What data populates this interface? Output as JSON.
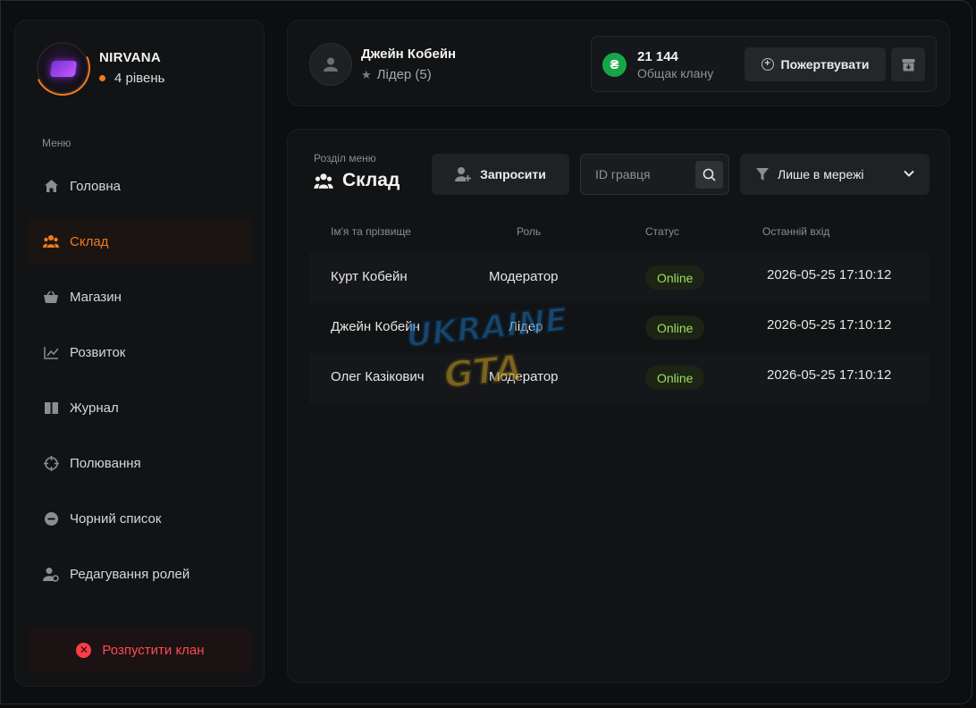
{
  "clan": {
    "name": "NIRVANA",
    "level": "4 рівень"
  },
  "sidebar": {
    "caption": "Меню",
    "items": [
      {
        "label": "Головна",
        "icon": "home-icon"
      },
      {
        "label": "Склад",
        "icon": "people-icon",
        "active": true
      },
      {
        "label": "Магазин",
        "icon": "basket-icon"
      },
      {
        "label": "Розвиток",
        "icon": "chart-icon"
      },
      {
        "label": "Журнал",
        "icon": "book-icon"
      },
      {
        "label": "Полювання",
        "icon": "crosshair-icon"
      },
      {
        "label": "Чорний список",
        "icon": "block-icon"
      },
      {
        "label": "Редагування ролей",
        "icon": "user-gear-icon"
      }
    ],
    "disband_label": "Розпустити клан"
  },
  "user": {
    "name": "Джейн Кобейн",
    "role": "Лідер (5)"
  },
  "treasury": {
    "amount": "21 144",
    "label": "Общак клану",
    "currency_symbol": "₴",
    "donate_label": "Пожертвувати"
  },
  "section": {
    "caption": "Розділ меню",
    "title": "Склад",
    "invite_label": "Запросити",
    "search_placeholder": "ID гравця",
    "filter_label": "Лише в мережі"
  },
  "table": {
    "headers": [
      "Ім'я та прізвище",
      "Роль",
      "Статус",
      "Останній вхід"
    ],
    "rows": [
      {
        "name": "Курт Кобейн",
        "role": "Модератор",
        "status": "Online",
        "last_login": "2026-05-25 17:10:12"
      },
      {
        "name": "Джейн Кобейн",
        "role": "Лідер",
        "status": "Online",
        "last_login": "2026-05-25 17:10:12"
      },
      {
        "name": "Олег Казікович",
        "role": "Модератор",
        "status": "Online",
        "last_login": "2026-05-25 17:10:12"
      }
    ]
  },
  "colors": {
    "accent": "#f07a1e",
    "danger": "#ff3b47",
    "online": "#9be05a",
    "coin": "#17a54a"
  }
}
